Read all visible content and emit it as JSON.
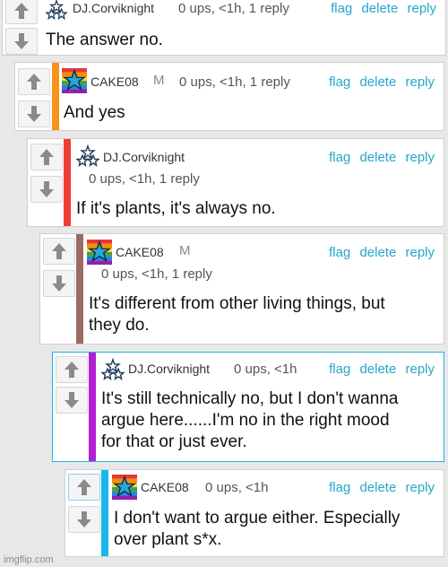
{
  "colors": {
    "link": "#26a6c9",
    "bar_orange": "#f7941d",
    "bar_red": "#ef3b36",
    "bar_brown": "#9b6a63",
    "bar_purple": "#b21fd2",
    "bar_cyan": "#1ab7ea"
  },
  "icons": {
    "upvote": "arrow-up-icon",
    "downvote": "arrow-down-icon",
    "avatar_cake": "rainbow-star-avatar",
    "avatar_dj": "three-stars-avatar"
  },
  "actions": {
    "flag": "flag",
    "delete": "delete",
    "reply": "reply"
  },
  "comments": [
    {
      "author": "DJ.Corviknight",
      "mod": "",
      "meta": "0 ups, <1h, 1 reply",
      "text": "The answer no."
    },
    {
      "author": "CAKE08",
      "mod": "M",
      "meta": "0 ups, <1h, 1 reply",
      "text": "And yes"
    },
    {
      "author": "DJ.Corviknight",
      "mod": "",
      "meta": "0 ups, <1h, 1 reply",
      "text": "If it's plants, it's always no."
    },
    {
      "author": "CAKE08",
      "mod": "M",
      "meta": "0 ups, <1h, 1 reply",
      "text": "It's different from other living things, but\nthey do."
    },
    {
      "author": "DJ.Corviknight",
      "mod": "",
      "meta": "0 ups, <1h",
      "text": "It's still technically no, but I don't wanna\nargue here......I'm no in the right mood\nfor that or just ever."
    },
    {
      "author": "CAKE08",
      "mod": "",
      "meta": "0 ups, <1h",
      "text": "I don't want to argue either. Especially\nover plant s*x."
    }
  ],
  "watermark": "imgflip.com"
}
